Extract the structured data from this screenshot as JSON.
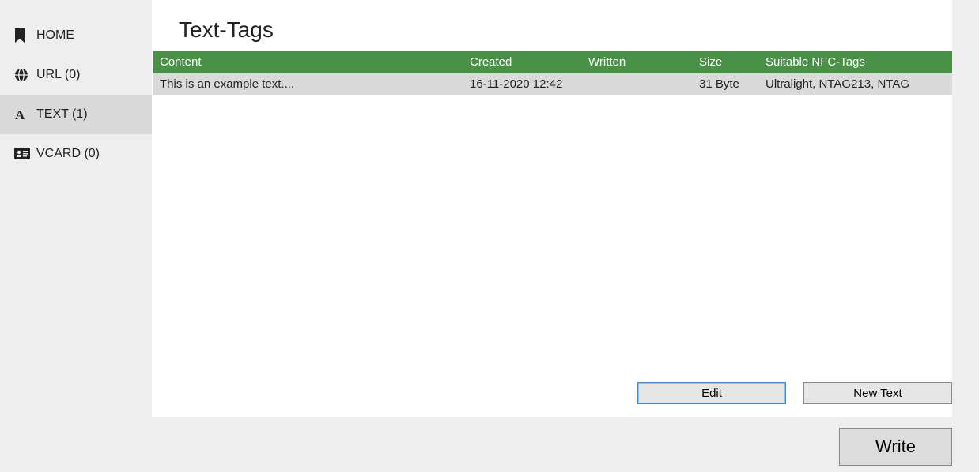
{
  "sidebar": {
    "items": [
      {
        "label": "HOME"
      },
      {
        "label": "URL (0)"
      },
      {
        "label": "TEXT (1)"
      },
      {
        "label": "VCARD (0)"
      }
    ]
  },
  "page": {
    "title": "Text-Tags"
  },
  "table": {
    "headers": {
      "content": "Content",
      "created": "Created",
      "written": "Written",
      "size": "Size",
      "tags": "Suitable NFC-Tags"
    },
    "rows": [
      {
        "content": "This is an example text....",
        "created": "16-11-2020 12:42",
        "written": "",
        "size": "31 Byte",
        "tags": "Ultralight, NTAG213, NTAG"
      }
    ]
  },
  "buttons": {
    "edit": "Edit",
    "new": "New Text",
    "write": "Write"
  },
  "colors": {
    "header_green": "#4a9148"
  }
}
